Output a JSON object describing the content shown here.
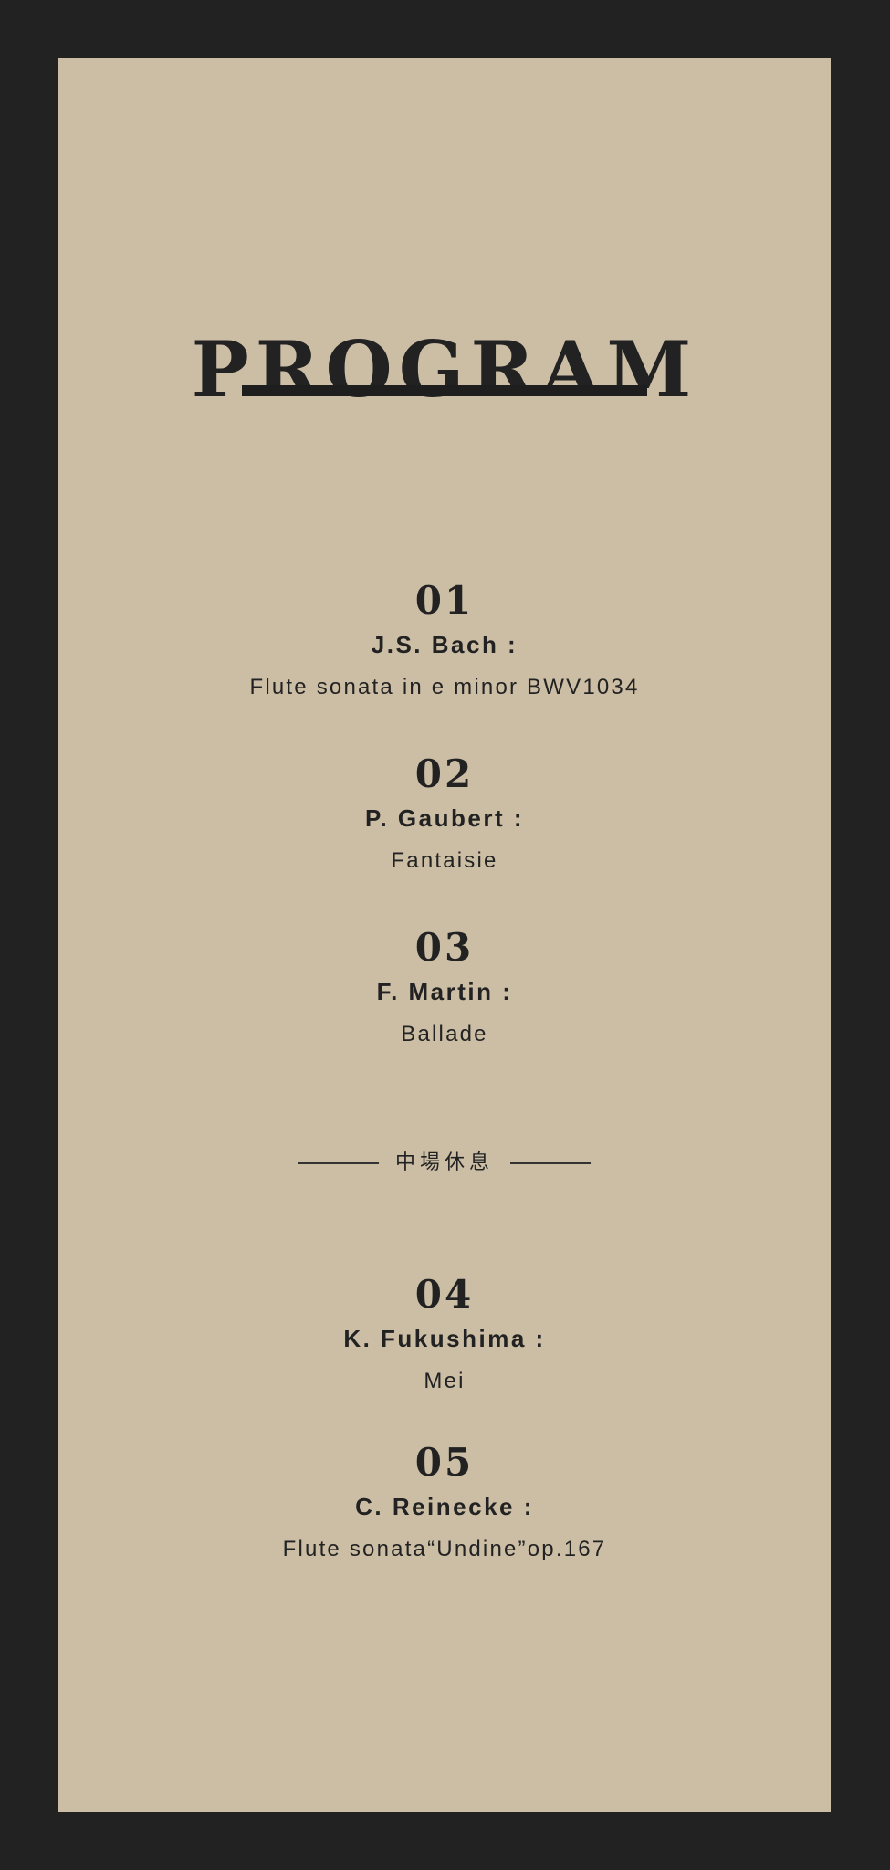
{
  "title": "PROGRAM",
  "items": [
    {
      "number": "01",
      "composer": "J.S. Bach :",
      "work": "Flute sonata in e minor BWV1034"
    },
    {
      "number": "02",
      "composer": "P. Gaubert :",
      "work": "Fantaisie"
    },
    {
      "number": "03",
      "composer": "F. Martin :",
      "work": "Ballade"
    },
    {
      "number": "04",
      "composer": "K. Fukushima :",
      "work": "Mei"
    },
    {
      "number": "05",
      "composer": "C. Reinecke :",
      "work": "Flute sonata“Undine”op.167"
    }
  ],
  "intermission": "中場休息",
  "colors": {
    "background": "#222222",
    "panel": "#ccbea5",
    "text": "#222222"
  }
}
